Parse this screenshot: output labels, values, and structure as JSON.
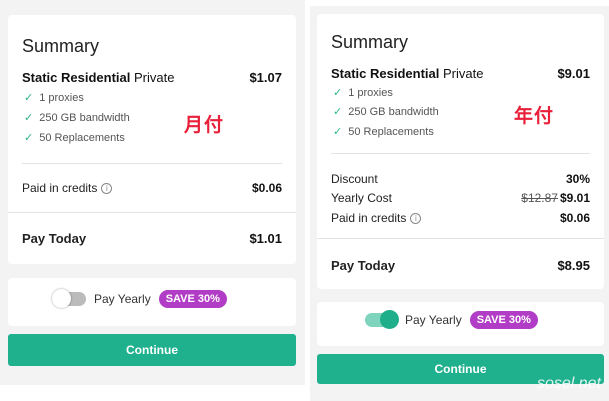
{
  "monthly": {
    "summary_title": "Summary",
    "plan_name": "Static Residential",
    "plan_tier": "Private",
    "plan_price": "$1.07",
    "features": [
      "1 proxies",
      "250 GB bandwidth",
      "50 Replacements"
    ],
    "annotation": "月付",
    "credits_label": "Paid in credits",
    "credits_value": "$0.06",
    "pay_today_label": "Pay Today",
    "pay_today_value": "$1.01",
    "toggle_label": "Pay Yearly",
    "toggle_on": false,
    "save_badge": "SAVE 30%",
    "continue_label": "Continue"
  },
  "yearly": {
    "summary_title": "Summary",
    "plan_name": "Static Residential",
    "plan_tier": "Private",
    "plan_price": "$9.01",
    "features": [
      "1 proxies",
      "250 GB bandwidth",
      "50 Replacements"
    ],
    "annotation": "年付",
    "discount_label": "Discount",
    "discount_value": "30%",
    "yearly_cost_label": "Yearly Cost",
    "yearly_cost_original": "$12.87",
    "yearly_cost_value": "$9.01",
    "credits_label": "Paid in credits",
    "credits_value": "$0.06",
    "pay_today_label": "Pay Today",
    "pay_today_value": "$8.95",
    "toggle_label": "Pay Yearly",
    "toggle_on": true,
    "save_badge": "SAVE 30%",
    "continue_label": "Continue"
  },
  "watermark": "sosel.net",
  "colors": {
    "accent_green": "#1fb08e",
    "badge_purple": "#b13cc5",
    "annotation_red": "#e8203a",
    "panel_bg": "#f3f3f3"
  },
  "icons": [
    "check-icon",
    "info-icon",
    "toggle-switch"
  ]
}
